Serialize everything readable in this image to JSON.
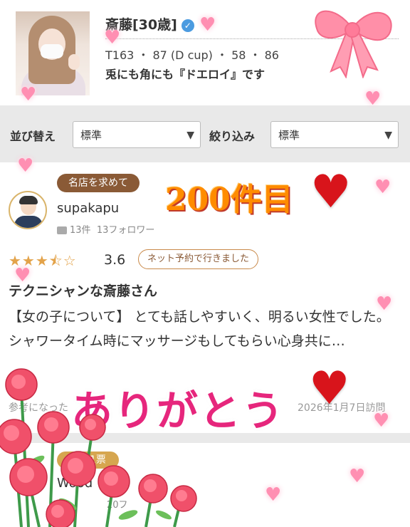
{
  "profile": {
    "name": "斎藤[30歳]",
    "stats": "T163 ・ 87 (D cup) ・ 58 ・ 86",
    "catchphrase": "兎にも角にも『ドエロイ』です"
  },
  "filters": {
    "sort_label": "並び替え",
    "sort_value": "標準",
    "filter_label": "絞り込み",
    "filter_value": "標準"
  },
  "review": {
    "badge": "名店を求めて",
    "username": "supakapu",
    "count": "13件",
    "followers": "13フォロワー",
    "stars_glyph": "★★★⯪☆",
    "score": "3.6",
    "booking_pill": "ネット予約で行きました",
    "title": "テクニシャンな斎藤さん",
    "body": "【女の子について】 とても話しやすいく、明るい女性でした。 シャワータイム時にマッサージもしてもらい心身共に…",
    "helpful": "参考になった",
    "visit_date": "2026年1月7日訪問"
  },
  "next_review": {
    "badge": "清き1票",
    "username": "Wood",
    "meta": "20フ"
  },
  "overlays": {
    "count_text": "200件目",
    "thanks_text": "ありがとう",
    "big_heart": "♥",
    "small_heart": "♥"
  },
  "colors": {
    "accent_brown": "#8a5a36",
    "heart_red": "#d8141b",
    "thanks_pink": "#e6267c",
    "count_orange": "#ff8c00",
    "filter_bg": "#e9e9e9"
  },
  "icons": {
    "verified": "verified-badge-icon",
    "dropdown": "chevron-down-icon",
    "comment": "comment-icon"
  }
}
